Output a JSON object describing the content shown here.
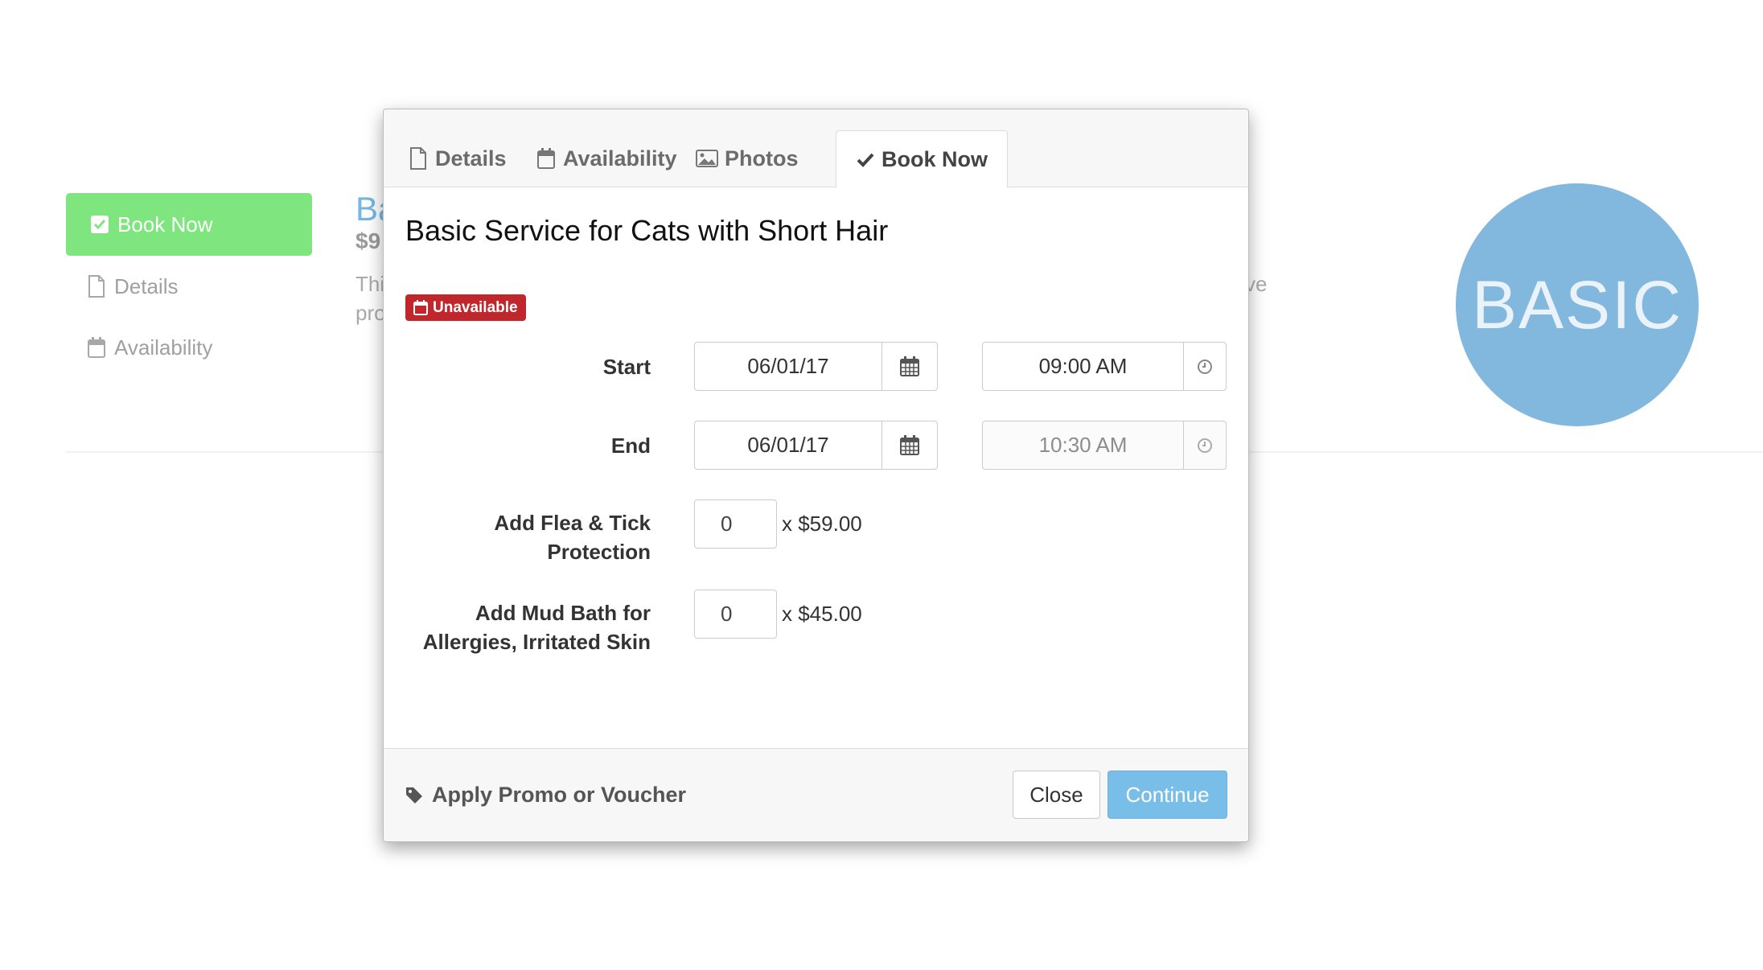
{
  "background": {
    "side_nav": {
      "book_now_label": "Book Now",
      "details_label": "Details",
      "availability_label": "Availability"
    },
    "title_partial": "Ba",
    "price_partial": "$9",
    "desc_line1_partial": "Thi",
    "desc_line2_partial": "pro",
    "desc_tail_partial": "ve",
    "badge_text": "BASIC",
    "colors": {
      "book_now_green": "#7fe57e",
      "badge_blue": "#83b8de",
      "title_blue": "#74b6e4"
    }
  },
  "modal": {
    "tabs": [
      {
        "label": "Details",
        "icon": "file-icon"
      },
      {
        "label": "Availability",
        "icon": "calendar-icon"
      },
      {
        "label": "Photos",
        "icon": "image-icon"
      },
      {
        "label": "Book Now",
        "icon": "check-icon",
        "active": true
      }
    ],
    "title": "Basic Service for Cats with Short Hair",
    "status_badge": "Unavailable",
    "start": {
      "label": "Start",
      "date": "06/01/17",
      "time": "09:00 AM"
    },
    "end": {
      "label": "End",
      "date": "06/01/17",
      "time": "10:30 AM"
    },
    "addons": [
      {
        "label_line1": "Add Flea & Tick",
        "label_line2": "Protection",
        "qty": "0",
        "price": "x $59.00"
      },
      {
        "label_line1": "Add Mud Bath for",
        "label_line2": "Allergies, Irritated Skin",
        "qty": "0",
        "price": "x $45.00"
      }
    ],
    "footer": {
      "promo_label": "Apply Promo or Voucher",
      "close_label": "Close",
      "continue_label": "Continue"
    },
    "colors": {
      "unavailable_red": "#c0272d",
      "continue_blue": "#79bde9"
    }
  }
}
